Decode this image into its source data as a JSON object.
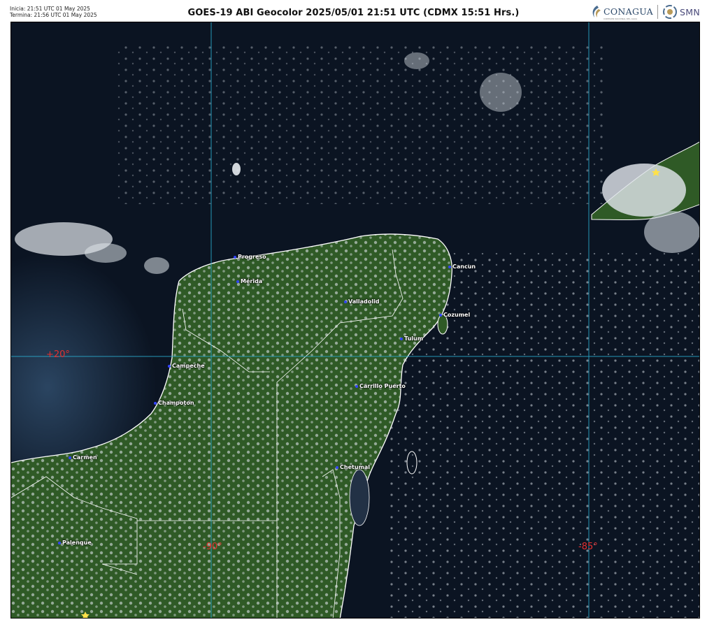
{
  "header": {
    "start_time": "Inicia: 21:51 UTC 01 May 2025",
    "end_time": "Termina: 21:56 UTC 01 May 2025",
    "title": "GOES-19 ABI Geocolor 2025/05/01 21:51 UTC (CDMX  15:51 Hrs.)",
    "logo_conagua": "CONAGUA",
    "logo_conagua_sub": "COMISIÓN NACIONAL DEL AGUA",
    "logo_smn": "SMN"
  },
  "cities": [
    {
      "id": "progreso",
      "name": "Progreso"
    },
    {
      "id": "merida",
      "name": "Mérida"
    },
    {
      "id": "valladolid",
      "name": "Valladolid"
    },
    {
      "id": "cancun",
      "name": "Cancun"
    },
    {
      "id": "cozumel",
      "name": "Cozumel"
    },
    {
      "id": "tulum",
      "name": "Tulum"
    },
    {
      "id": "campeche",
      "name": "Campeche"
    },
    {
      "id": "champoton",
      "name": "Champoton"
    },
    {
      "id": "carrillo-puerto",
      "name": "Carrillo Puerto"
    },
    {
      "id": "carmen",
      "name": "Carmen"
    },
    {
      "id": "chetumal",
      "name": "Chetumal"
    },
    {
      "id": "palenque",
      "name": "Palenque"
    }
  ],
  "grid_labels": {
    "lat_20": "+20°",
    "lon_90": "-90°",
    "lon_85": "-85°"
  },
  "colors": {
    "ocean": "#0b1422",
    "land": "#2f5a26",
    "cloud": "#dfe4ea",
    "gridline": "#2aa7c9",
    "border": "#ffffff",
    "coord_label": "#e23030",
    "city_dot": "#3344ff"
  },
  "icons": [
    "conagua-logo-icon",
    "smn-logo-icon",
    "star-marker-icon"
  ]
}
